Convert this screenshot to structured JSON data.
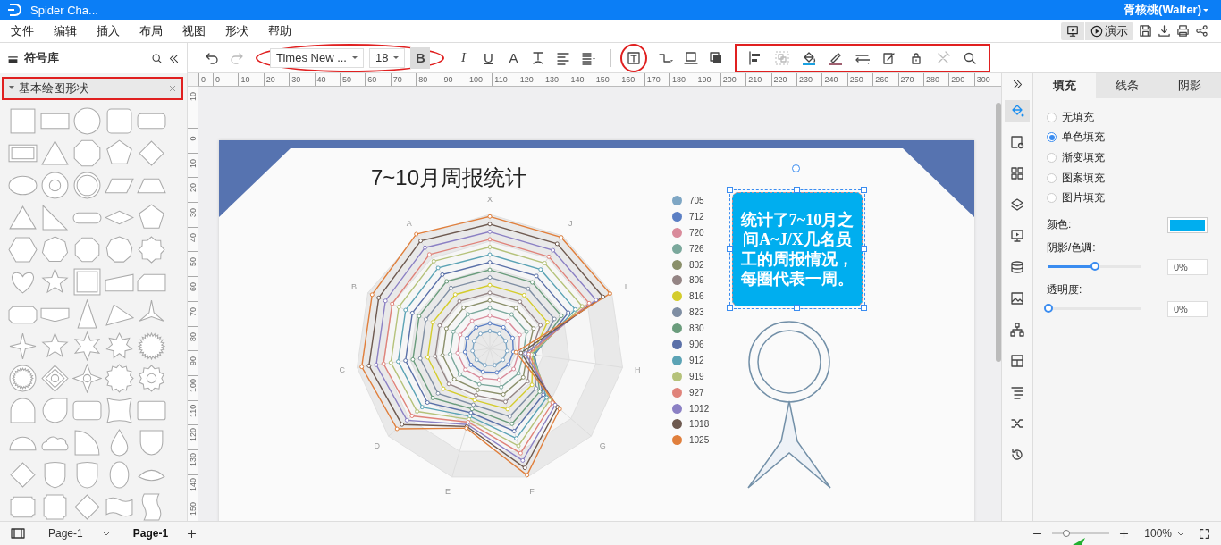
{
  "window": {
    "title": "Spider Cha...",
    "user": "胥核桃(Walter)"
  },
  "menu": [
    "文件",
    "编辑",
    "插入",
    "布局",
    "视图",
    "形状",
    "帮助"
  ],
  "present": {
    "label": "演示"
  },
  "library": {
    "title": "符号库",
    "category": {
      "label": "基本绘图形状",
      "expanded": true,
      "highlighted": true
    }
  },
  "toolbar": {
    "groups": [
      {
        "kind": "plain",
        "items": [
          {
            "kind": "undo",
            "disabled": false
          },
          {
            "kind": "redo",
            "disabled": true
          }
        ]
      },
      {
        "kind": "ellipse",
        "items": [
          {
            "kind": "font-select",
            "value": "Times New ..."
          },
          {
            "kind": "size-select",
            "value": "18"
          },
          {
            "kind": "bold",
            "label": "B",
            "selected": true
          }
        ]
      },
      {
        "kind": "plain",
        "items": [
          {
            "kind": "italic",
            "label": "I",
            "selected": false
          },
          {
            "kind": "underline",
            "label": "U",
            "selected": false
          },
          {
            "kind": "font-color",
            "label": "A",
            "selected": false
          },
          {
            "kind": "text-style",
            "disabled": false
          },
          {
            "kind": "align",
            "disabled": false
          },
          {
            "kind": "spacing",
            "disabled": false
          }
        ]
      },
      {
        "kind": "circle",
        "items": [
          {
            "kind": "textbox",
            "disabled": false
          }
        ]
      },
      {
        "kind": "plain",
        "items": [
          {
            "kind": "connector",
            "disabled": false
          },
          {
            "kind": "container",
            "disabled": false
          },
          {
            "kind": "front",
            "disabled": false
          }
        ]
      },
      {
        "kind": "rect",
        "items": [
          {
            "kind": "align-left",
            "disabled": false
          },
          {
            "kind": "group",
            "disabled": true
          },
          {
            "kind": "fill",
            "disabled": false
          },
          {
            "kind": "line-color",
            "disabled": false
          },
          {
            "kind": "line-style",
            "disabled": false
          },
          {
            "kind": "edit",
            "disabled": false
          },
          {
            "kind": "lock",
            "disabled": false
          },
          {
            "kind": "tools",
            "disabled": true
          },
          {
            "kind": "search",
            "disabled": false
          }
        ]
      }
    ]
  },
  "ruler": {
    "horizontal": [
      "0",
      "0",
      "10",
      "20",
      "30",
      "40",
      "50",
      "60",
      "70",
      "80",
      "90",
      "100",
      "110",
      "120",
      "130",
      "140",
      "150",
      "160",
      "170",
      "180",
      "190",
      "200",
      "210",
      "220",
      "230",
      "240",
      "250",
      "260",
      "270",
      "280",
      "290",
      "300"
    ],
    "vertical": [
      "10",
      "0",
      "10",
      "20",
      "30",
      "40",
      "50",
      "60",
      "70",
      "80",
      "90",
      "100",
      "110",
      "120",
      "130",
      "140",
      "150"
    ]
  },
  "canvas": {
    "title": "7~10月周报统计",
    "radar": {
      "axes": [
        "X",
        "J",
        "I",
        "H",
        "G",
        "F",
        "E",
        "D",
        "C",
        "B",
        "A"
      ],
      "legend": [
        {
          "label": "705",
          "color": "#7ea6c4"
        },
        {
          "label": "712",
          "color": "#5b7fc4"
        },
        {
          "label": "720",
          "color": "#d98b9b"
        },
        {
          "label": "726",
          "color": "#7aa89c"
        },
        {
          "label": "802",
          "color": "#8a8f6a"
        },
        {
          "label": "809",
          "color": "#948484"
        },
        {
          "label": "816",
          "color": "#d4cc2c"
        },
        {
          "label": "823",
          "color": "#7f8ea3"
        },
        {
          "label": "830",
          "color": "#6a9c7c"
        },
        {
          "label": "906",
          "color": "#5a70a8"
        },
        {
          "label": "912",
          "color": "#5ba3b5"
        },
        {
          "label": "919",
          "color": "#b5c27a"
        },
        {
          "label": "927",
          "color": "#e0837a"
        },
        {
          "label": "1012",
          "color": "#8b80c4"
        },
        {
          "label": "1018",
          "color": "#6e5a50"
        },
        {
          "label": "1025",
          "color": "#e07f3c"
        }
      ]
    },
    "note": {
      "text": "统计了7~10月之间A~J/X几名员工的周报情况，每圈代表一周。",
      "selected": true
    }
  },
  "side_icons": [
    {
      "kind": "fill",
      "selected": true
    },
    {
      "kind": "page-settings",
      "selected": false
    },
    {
      "kind": "grid",
      "selected": false
    },
    {
      "kind": "layers",
      "selected": false
    },
    {
      "kind": "presentation",
      "selected": false
    },
    {
      "kind": "database",
      "selected": false
    },
    {
      "kind": "image",
      "selected": false
    },
    {
      "kind": "org-chart",
      "selected": false
    },
    {
      "kind": "layout",
      "selected": false
    },
    {
      "kind": "list",
      "selected": false
    },
    {
      "kind": "shuffle",
      "selected": false
    },
    {
      "kind": "history",
      "selected": false
    }
  ],
  "properties": {
    "tabs": [
      {
        "label": "填充",
        "selected": true
      },
      {
        "label": "线条",
        "selected": false
      },
      {
        "label": "阴影",
        "selected": false
      }
    ],
    "fill_options": [
      {
        "label": "无填充",
        "selected": false
      },
      {
        "label": "单色填充",
        "selected": true
      },
      {
        "label": "渐变填充",
        "selected": false
      },
      {
        "label": "图案填充",
        "selected": false
      },
      {
        "label": "图片填充",
        "selected": false
      }
    ],
    "color": {
      "label": "颜色:",
      "color": "#00aeef"
    },
    "sliders": [
      {
        "label": "阴影/色调:",
        "level": 0.5,
        "value": "0%"
      },
      {
        "label": "透明度:",
        "level": 0,
        "value": "0%"
      }
    ]
  },
  "status_bar": {
    "page_select": "Page-1",
    "tabs": [
      {
        "label": "Page-1",
        "selected": true
      }
    ],
    "zoom": {
      "level": 0.25,
      "value": "100%"
    }
  }
}
